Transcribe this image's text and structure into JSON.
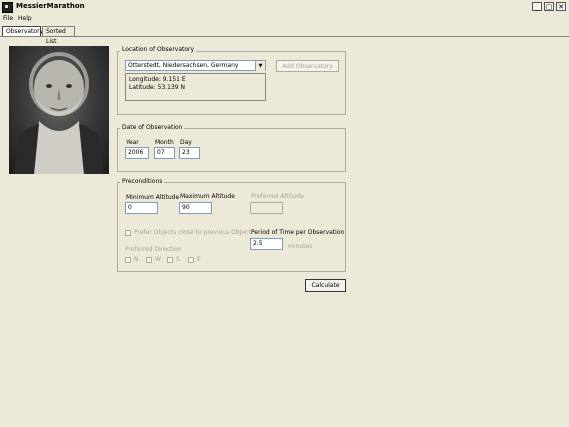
{
  "app": {
    "title": "MessierMarathon"
  },
  "window_buttons": {
    "minimize": "_",
    "maximize": "▢",
    "close": "✕"
  },
  "menu": {
    "file": "File",
    "help": "Help"
  },
  "tabs": [
    {
      "label": "Observatory"
    },
    {
      "label": "Sorted List"
    }
  ],
  "location": {
    "group_label": "Location of Observatory",
    "selected": "Otterstedt, Niedersachsen, Germany",
    "longitude": "Longitude: 9.151 E",
    "latitude": "Latitude: 53.139 N",
    "add_button": "Add Observatory"
  },
  "date": {
    "group_label": "Date of Observation",
    "year_label": "Year",
    "year": "2006",
    "month_label": "Month",
    "month": "07",
    "day_label": "Day",
    "day": "23"
  },
  "preconditions": {
    "group_label": "Preconditions",
    "min_alt_label": "Minimum Altitude",
    "min_alt": "0",
    "max_alt_label": "Maximum Altitude",
    "max_alt": "90",
    "pref_alt_label": "Preferred Altitude",
    "pref_alt": "",
    "prefer_close_label": "Prefer Objects close to previous Object",
    "pref_dir_label": "Preferred Direction",
    "directions": [
      "N",
      "W",
      "S",
      "E"
    ],
    "period_label": "Period of Time per Observation",
    "period": "2.5",
    "period_unit": "minutes"
  },
  "calculate_button": "Calculate"
}
